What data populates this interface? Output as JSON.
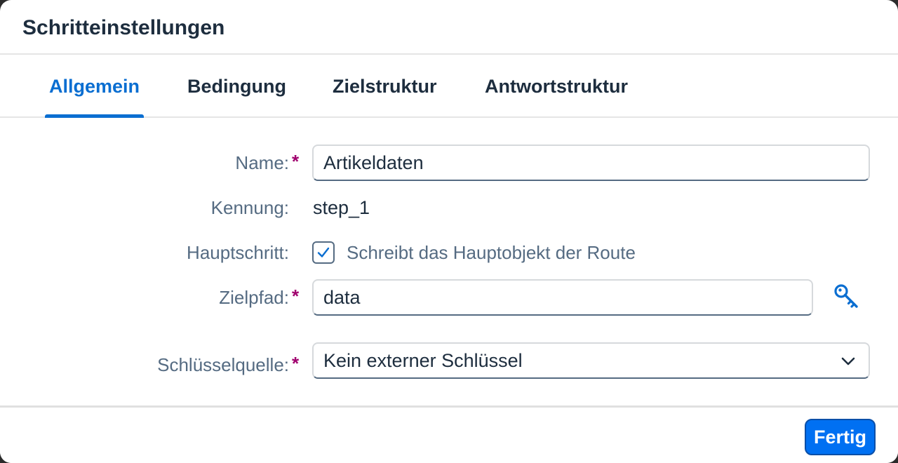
{
  "dialog": {
    "title": "Schritteinstellungen"
  },
  "tabs": [
    {
      "label": "Allgemein",
      "active": true
    },
    {
      "label": "Bedingung",
      "active": false
    },
    {
      "label": "Zielstruktur",
      "active": false
    },
    {
      "label": "Antwortstruktur",
      "active": false
    }
  ],
  "form": {
    "name": {
      "label": "Name:",
      "required_marker": "*",
      "value": "Artikeldaten"
    },
    "kennung": {
      "label": "Kennung:",
      "value": "step_1"
    },
    "hauptschritt": {
      "label": "Hauptschritt:",
      "checked": true,
      "checkbox_label": "Schreibt das Hauptobjekt der Route"
    },
    "zielpfad": {
      "label": "Zielpfad:",
      "required_marker": "*",
      "value": "data",
      "icon": "key-icon"
    },
    "schluesselquelle": {
      "label": "Schlüsselquelle:",
      "required_marker": "*",
      "selected": "Kein externer Schlüssel",
      "icon": "chevron-down-icon"
    }
  },
  "footer": {
    "done_label": "Fertig"
  },
  "colors": {
    "accent": "#0a6ed1",
    "button": "#0070f2",
    "required": "#a0006e",
    "label": "#556b82",
    "text": "#1d2d3e"
  }
}
